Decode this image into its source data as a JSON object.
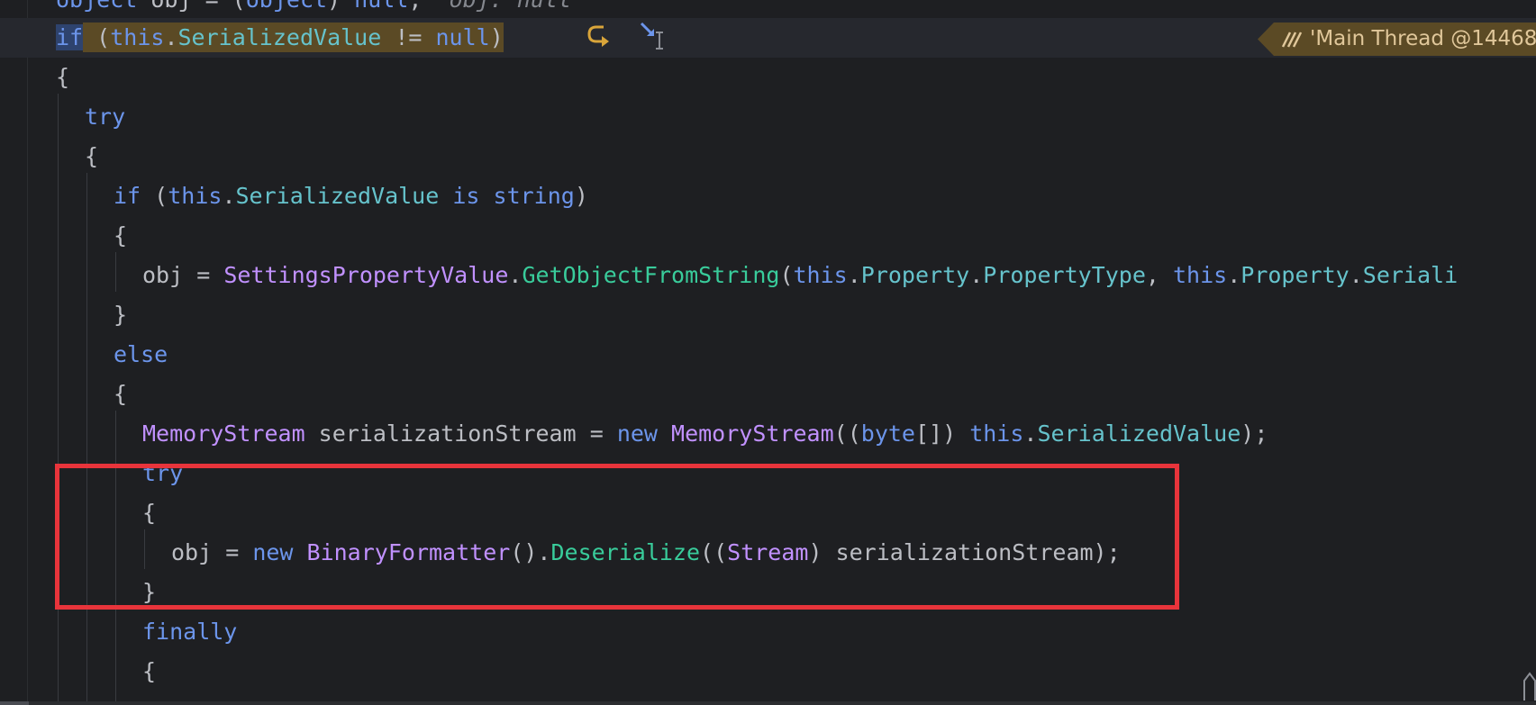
{
  "editor": {
    "lines": [
      {
        "segments": [
          {
            "t": "object",
            "c": "kw"
          },
          {
            "t": " obj = (",
            "c": "plain"
          },
          {
            "t": "object",
            "c": "kw"
          },
          {
            "t": ") ",
            "c": "plain"
          },
          {
            "t": "null",
            "c": "kw"
          },
          {
            "t": ";  ",
            "c": "plain"
          },
          {
            "t": "obj: null",
            "c": "ct"
          }
        ]
      },
      {
        "segments": [
          {
            "t": "if",
            "c": "kw"
          },
          {
            "t": " (",
            "c": "plain"
          },
          {
            "t": "this",
            "c": "kw"
          },
          {
            "t": ".",
            "c": "plain"
          },
          {
            "t": "SerializedValue",
            "c": "pr"
          },
          {
            "t": " != ",
            "c": "plain"
          },
          {
            "t": "null",
            "c": "kw"
          },
          {
            "t": ")",
            "c": "plain"
          }
        ]
      },
      {
        "segments": [
          {
            "t": "{",
            "c": "plain"
          }
        ]
      },
      {
        "segments": [
          {
            "t": "try",
            "c": "kw"
          }
        ]
      },
      {
        "segments": [
          {
            "t": "{",
            "c": "plain"
          }
        ]
      },
      {
        "segments": [
          {
            "t": "if",
            "c": "kw"
          },
          {
            "t": " (",
            "c": "plain"
          },
          {
            "t": "this",
            "c": "kw"
          },
          {
            "t": ".",
            "c": "plain"
          },
          {
            "t": "SerializedValue",
            "c": "pr"
          },
          {
            "t": " ",
            "c": "plain"
          },
          {
            "t": "is",
            "c": "kw"
          },
          {
            "t": " ",
            "c": "plain"
          },
          {
            "t": "string",
            "c": "kw"
          },
          {
            "t": ")",
            "c": "plain"
          }
        ]
      },
      {
        "segments": [
          {
            "t": "{",
            "c": "plain"
          }
        ]
      },
      {
        "segments": [
          {
            "t": "obj = ",
            "c": "plain"
          },
          {
            "t": "SettingsPropertyValue",
            "c": "ty"
          },
          {
            "t": ".",
            "c": "plain"
          },
          {
            "t": "GetObjectFromString",
            "c": "fn"
          },
          {
            "t": "(",
            "c": "plain"
          },
          {
            "t": "this",
            "c": "kw"
          },
          {
            "t": ".",
            "c": "plain"
          },
          {
            "t": "Property",
            "c": "pr"
          },
          {
            "t": ".",
            "c": "plain"
          },
          {
            "t": "PropertyType",
            "c": "pr"
          },
          {
            "t": ", ",
            "c": "plain"
          },
          {
            "t": "this",
            "c": "kw"
          },
          {
            "t": ".",
            "c": "plain"
          },
          {
            "t": "Property",
            "c": "pr"
          },
          {
            "t": ".",
            "c": "plain"
          },
          {
            "t": "Seriali",
            "c": "pr"
          }
        ]
      },
      {
        "segments": [
          {
            "t": "}",
            "c": "plain"
          }
        ]
      },
      {
        "segments": [
          {
            "t": "else",
            "c": "kw"
          }
        ]
      },
      {
        "segments": [
          {
            "t": "{",
            "c": "plain"
          }
        ]
      },
      {
        "segments": [
          {
            "t": "MemoryStream",
            "c": "ty"
          },
          {
            "t": " serializationStream = ",
            "c": "plain"
          },
          {
            "t": "new",
            "c": "kw"
          },
          {
            "t": " ",
            "c": "plain"
          },
          {
            "t": "MemoryStream",
            "c": "ty"
          },
          {
            "t": "((",
            "c": "plain"
          },
          {
            "t": "byte",
            "c": "kw"
          },
          {
            "t": "[]) ",
            "c": "plain"
          },
          {
            "t": "this",
            "c": "kw"
          },
          {
            "t": ".",
            "c": "plain"
          },
          {
            "t": "SerializedValue",
            "c": "pr"
          },
          {
            "t": ");",
            "c": "plain"
          }
        ]
      },
      {
        "segments": [
          {
            "t": "try",
            "c": "kw"
          }
        ]
      },
      {
        "segments": [
          {
            "t": "{",
            "c": "plain"
          }
        ]
      },
      {
        "segments": [
          {
            "t": "obj = ",
            "c": "plain"
          },
          {
            "t": "new",
            "c": "kw"
          },
          {
            "t": " ",
            "c": "plain"
          },
          {
            "t": "BinaryFormatter",
            "c": "ty"
          },
          {
            "t": "().",
            "c": "plain"
          },
          {
            "t": "Deserialize",
            "c": "fn"
          },
          {
            "t": "((",
            "c": "plain"
          },
          {
            "t": "Stream",
            "c": "ty"
          },
          {
            "t": ") serializationStream);",
            "c": "plain"
          }
        ]
      },
      {
        "segments": [
          {
            "t": "}",
            "c": "plain"
          }
        ]
      },
      {
        "segments": [
          {
            "t": "finally",
            "c": "kw"
          }
        ]
      },
      {
        "segments": [
          {
            "t": "{",
            "c": "plain"
          }
        ]
      }
    ]
  },
  "debugger": {
    "thread_label": "'Main Thread @14468",
    "step_icon": "step-into-icon",
    "cursor_icon": "run-to-cursor-icon",
    "thread_icon": "thread-icon"
  },
  "colors": {
    "background": "#1e1f22",
    "keyword": "#6c95eb",
    "type": "#c191ff",
    "method": "#39cc9b",
    "property": "#66c3cc",
    "execution_highlight": "#5b4a25",
    "annotation_box": "#e8343b"
  }
}
